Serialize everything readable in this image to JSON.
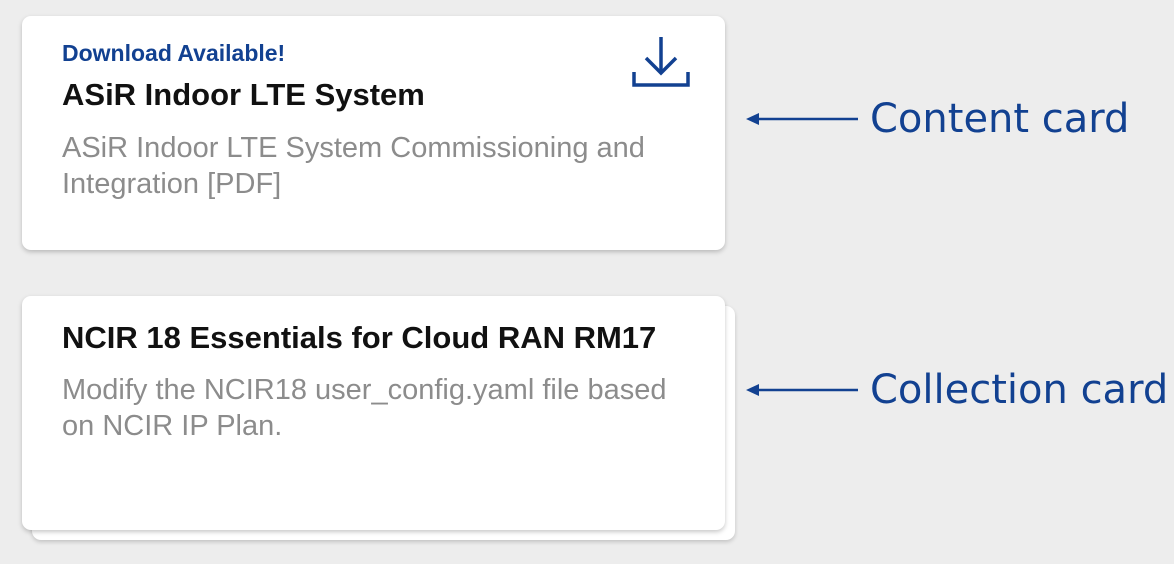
{
  "content_card": {
    "kicker": "Download Available!",
    "title": "ASiR Indoor LTE System",
    "description": "ASiR Indoor LTE System Commissioning and Integration [PDF]",
    "icon": "download-icon"
  },
  "collection_card": {
    "title": "NCIR 18 Essentials for Cloud RAN RM17",
    "description": "Modify the NCIR18 user_config.yaml file based on NCIR IP Plan."
  },
  "annotations": {
    "content_label": "Content card",
    "collection_label": "Collection card"
  },
  "colors": {
    "accent": "#124191",
    "background": "#ededed",
    "card": "#ffffff",
    "muted_text": "#8c8c8c"
  }
}
